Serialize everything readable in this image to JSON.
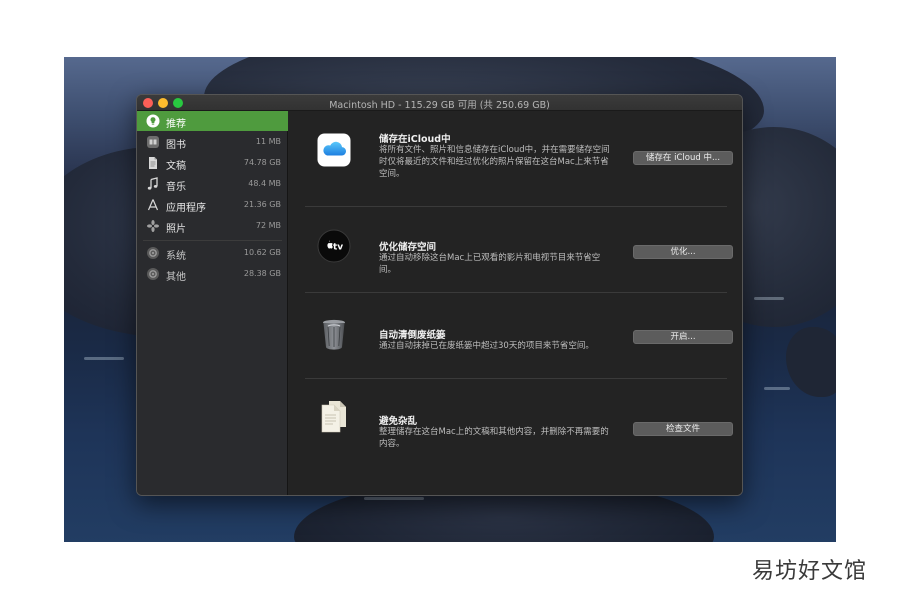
{
  "window": {
    "title": "Macintosh HD - 115.29 GB 可用 (共 250.69 GB)"
  },
  "sidebar": {
    "items": [
      {
        "label": "推荐",
        "size": "",
        "icon": "lightbulb-icon",
        "selected": true
      },
      {
        "label": "图书",
        "size": "11 MB",
        "icon": "book-icon"
      },
      {
        "label": "文稿",
        "size": "74.78 GB",
        "icon": "document-icon"
      },
      {
        "label": "音乐",
        "size": "48.4 MB",
        "icon": "music-note-icon"
      },
      {
        "label": "应用程序",
        "size": "21.36 GB",
        "icon": "app-store-icon"
      },
      {
        "label": "照片",
        "size": "72 MB",
        "icon": "photos-icon"
      },
      {
        "label": "系统",
        "size": "10.62 GB",
        "icon": "gear-icon"
      },
      {
        "label": "其他",
        "size": "28.38 GB",
        "icon": "gear-icon"
      }
    ]
  },
  "recommendations": [
    {
      "title": "储存在iCloud中",
      "description": "将所有文件、照片和信息储存在iCloud中，并在需要储存空间时仅将最近的文件和经过优化的照片保留在这台Mac上来节省空间。",
      "button": "储存在 iCloud 中...",
      "icon": "icloud-icon"
    },
    {
      "title": "优化储存空间",
      "description": "通过自动移除这台Mac上已观看的影片和电视节目来节省空间。",
      "button": "优化...",
      "icon": "apple-tv-icon",
      "icon_text": "tv"
    },
    {
      "title": "自动清倒废纸篓",
      "description": "通过自动抹掉已在废纸篓中超过30天的项目来节省空间。",
      "button": "开启...",
      "icon": "trash-icon"
    },
    {
      "title": "避免杂乱",
      "description": "整理储存在这台Mac上的文稿和其他内容，并删除不再需要的内容。",
      "button": "检查文件",
      "icon": "documents-icon"
    }
  ],
  "watermark": "易坊好文馆",
  "colors": {
    "sidebar_selected": "#4f9b3e",
    "window_bg": "#232323",
    "button_bg": "#5c5c5c"
  }
}
